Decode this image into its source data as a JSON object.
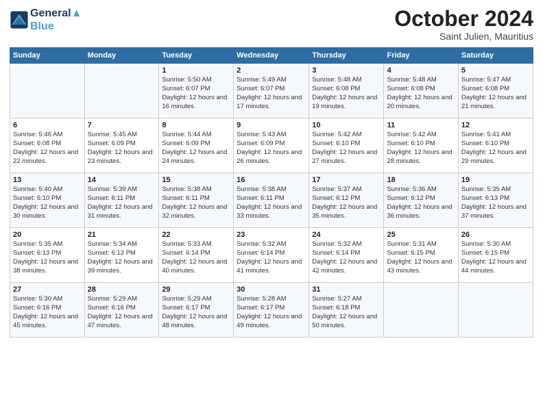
{
  "logo": {
    "line1": "General",
    "line2": "Blue"
  },
  "title": "October 2024",
  "subtitle": "Saint Julien, Mauritius",
  "days_header": [
    "Sunday",
    "Monday",
    "Tuesday",
    "Wednesday",
    "Thursday",
    "Friday",
    "Saturday"
  ],
  "weeks": [
    [
      {
        "day": "",
        "info": ""
      },
      {
        "day": "",
        "info": ""
      },
      {
        "day": "1",
        "info": "Sunrise: 5:50 AM\nSunset: 6:07 PM\nDaylight: 12 hours and 16 minutes."
      },
      {
        "day": "2",
        "info": "Sunrise: 5:49 AM\nSunset: 6:07 PM\nDaylight: 12 hours and 17 minutes."
      },
      {
        "day": "3",
        "info": "Sunrise: 5:48 AM\nSunset: 6:08 PM\nDaylight: 12 hours and 19 minutes."
      },
      {
        "day": "4",
        "info": "Sunrise: 5:48 AM\nSunset: 6:08 PM\nDaylight: 12 hours and 20 minutes."
      },
      {
        "day": "5",
        "info": "Sunrise: 5:47 AM\nSunset: 6:08 PM\nDaylight: 12 hours and 21 minutes."
      }
    ],
    [
      {
        "day": "6",
        "info": "Sunrise: 5:46 AM\nSunset: 6:08 PM\nDaylight: 12 hours and 22 minutes."
      },
      {
        "day": "7",
        "info": "Sunrise: 5:45 AM\nSunset: 6:09 PM\nDaylight: 12 hours and 23 minutes."
      },
      {
        "day": "8",
        "info": "Sunrise: 5:44 AM\nSunset: 6:09 PM\nDaylight: 12 hours and 24 minutes."
      },
      {
        "day": "9",
        "info": "Sunrise: 5:43 AM\nSunset: 6:09 PM\nDaylight: 12 hours and 26 minutes."
      },
      {
        "day": "10",
        "info": "Sunrise: 5:42 AM\nSunset: 6:10 PM\nDaylight: 12 hours and 27 minutes."
      },
      {
        "day": "11",
        "info": "Sunrise: 5:42 AM\nSunset: 6:10 PM\nDaylight: 12 hours and 28 minutes."
      },
      {
        "day": "12",
        "info": "Sunrise: 5:41 AM\nSunset: 6:10 PM\nDaylight: 12 hours and 29 minutes."
      }
    ],
    [
      {
        "day": "13",
        "info": "Sunrise: 5:40 AM\nSunset: 6:10 PM\nDaylight: 12 hours and 30 minutes."
      },
      {
        "day": "14",
        "info": "Sunrise: 5:39 AM\nSunset: 6:11 PM\nDaylight: 12 hours and 31 minutes."
      },
      {
        "day": "15",
        "info": "Sunrise: 5:38 AM\nSunset: 6:11 PM\nDaylight: 12 hours and 32 minutes."
      },
      {
        "day": "16",
        "info": "Sunrise: 5:38 AM\nSunset: 6:11 PM\nDaylight: 12 hours and 33 minutes."
      },
      {
        "day": "17",
        "info": "Sunrise: 5:37 AM\nSunset: 6:12 PM\nDaylight: 12 hours and 35 minutes."
      },
      {
        "day": "18",
        "info": "Sunrise: 5:36 AM\nSunset: 6:12 PM\nDaylight: 12 hours and 36 minutes."
      },
      {
        "day": "19",
        "info": "Sunrise: 5:35 AM\nSunset: 6:13 PM\nDaylight: 12 hours and 37 minutes."
      }
    ],
    [
      {
        "day": "20",
        "info": "Sunrise: 5:35 AM\nSunset: 6:13 PM\nDaylight: 12 hours and 38 minutes."
      },
      {
        "day": "21",
        "info": "Sunrise: 5:34 AM\nSunset: 6:13 PM\nDaylight: 12 hours and 39 minutes."
      },
      {
        "day": "22",
        "info": "Sunrise: 5:33 AM\nSunset: 6:14 PM\nDaylight: 12 hours and 40 minutes."
      },
      {
        "day": "23",
        "info": "Sunrise: 5:32 AM\nSunset: 6:14 PM\nDaylight: 12 hours and 41 minutes."
      },
      {
        "day": "24",
        "info": "Sunrise: 5:32 AM\nSunset: 6:14 PM\nDaylight: 12 hours and 42 minutes."
      },
      {
        "day": "25",
        "info": "Sunrise: 5:31 AM\nSunset: 6:15 PM\nDaylight: 12 hours and 43 minutes."
      },
      {
        "day": "26",
        "info": "Sunrise: 5:30 AM\nSunset: 6:15 PM\nDaylight: 12 hours and 44 minutes."
      }
    ],
    [
      {
        "day": "27",
        "info": "Sunrise: 5:30 AM\nSunset: 6:16 PM\nDaylight: 12 hours and 45 minutes."
      },
      {
        "day": "28",
        "info": "Sunrise: 5:29 AM\nSunset: 6:16 PM\nDaylight: 12 hours and 47 minutes."
      },
      {
        "day": "29",
        "info": "Sunrise: 5:29 AM\nSunset: 6:17 PM\nDaylight: 12 hours and 48 minutes."
      },
      {
        "day": "30",
        "info": "Sunrise: 5:28 AM\nSunset: 6:17 PM\nDaylight: 12 hours and 49 minutes."
      },
      {
        "day": "31",
        "info": "Sunrise: 5:27 AM\nSunset: 6:18 PM\nDaylight: 12 hours and 50 minutes."
      },
      {
        "day": "",
        "info": ""
      },
      {
        "day": "",
        "info": ""
      }
    ]
  ]
}
